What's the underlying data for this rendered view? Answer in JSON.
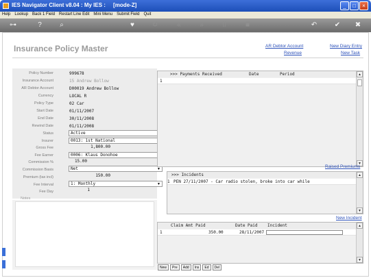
{
  "window": {
    "title": "IES Navigator Client v8.04 : My IES :     [mode-Z]"
  },
  "menu": [
    "Help",
    "Lookup",
    "Back 1 Field",
    "Restart Line Edit",
    "Mini Menu",
    "Submit Field",
    "Quit"
  ],
  "toolbar_icons": [
    "key-icon",
    "help-icon",
    "search-icon",
    "heart-icon",
    "refresh-icon",
    "rewind-icon",
    "fast-forward-icon",
    "bookmark-icon",
    "stop-icon",
    "back-icon",
    "check-icon",
    "close-icon"
  ],
  "page": {
    "title": "Insurance Policy Master"
  },
  "links": {
    "ar_debtor_account": "AR Debtor Account",
    "revenue": "Revenue",
    "new_diary_entry": "New Diary Entry",
    "new_task": "New Task",
    "raised_premiums": "Raised Premiums",
    "new_incident": "New Incident"
  },
  "form": {
    "policy_number": {
      "label": "Policy Number",
      "value": "999678"
    },
    "insurance_account": {
      "label": "Insurance Account",
      "value": "15 Andrew Bollow"
    },
    "ar_debtor_account": {
      "label": "AR Debtor Account",
      "value": "D00019 Andrew Bollow"
    },
    "currency": {
      "label": "Currency",
      "value": "LOCAL R"
    },
    "policy_type": {
      "label": "Policy Type",
      "value": "02 Car"
    },
    "start_date": {
      "label": "Start Date",
      "value": "01/11/2007"
    },
    "end_date": {
      "label": "End Date",
      "value": "30/11/2008"
    },
    "rewind_date": {
      "label": "Rewind Date",
      "value": "01/11/2008"
    },
    "status": {
      "label": "Status",
      "value": "Active"
    },
    "insurer": {
      "label": "Insurer",
      "value": "0013: 1st National"
    },
    "gross_fee": {
      "label": "Gross Fee",
      "value": "1,800.00"
    },
    "fee_earner": {
      "label": "Fee Earner",
      "value": "0006: Klaus Donohoe"
    },
    "commission_pct": {
      "label": "Commission %",
      "value": "15.00"
    },
    "commission_basis": {
      "label": "Commission Basis",
      "value": "Net"
    },
    "premium": {
      "label": "Premium (tax incl)",
      "value": "150.00"
    },
    "fee_interval": {
      "label": "Fee Interval",
      "value": "1: Monthly"
    },
    "fee_day": {
      "label": "Fee Day",
      "value": "1"
    },
    "notes": {
      "label": "Notes"
    }
  },
  "payments": {
    "headers": {
      "title": ">>> Payments Received",
      "date": "Date",
      "period": "Period"
    },
    "rows": [
      {
        "num": "1"
      }
    ]
  },
  "incidents": {
    "headers": {
      "title": ">>> Incidents"
    },
    "rows": [
      {
        "num": "1",
        "text": "PEN 27/11/2007 - Car radio stolen, broke into car while"
      }
    ]
  },
  "claims": {
    "headers": {
      "amt": "Claim Amt Paid",
      "date": "Date Paid",
      "incident": "Incident"
    },
    "rows": [
      {
        "num": "1",
        "amt": "350.00",
        "date": "28/11/2007"
      }
    ]
  },
  "bottom_buttons": [
    "New",
    "Pre",
    "Add",
    "Ins",
    "Ed",
    "Del"
  ]
}
